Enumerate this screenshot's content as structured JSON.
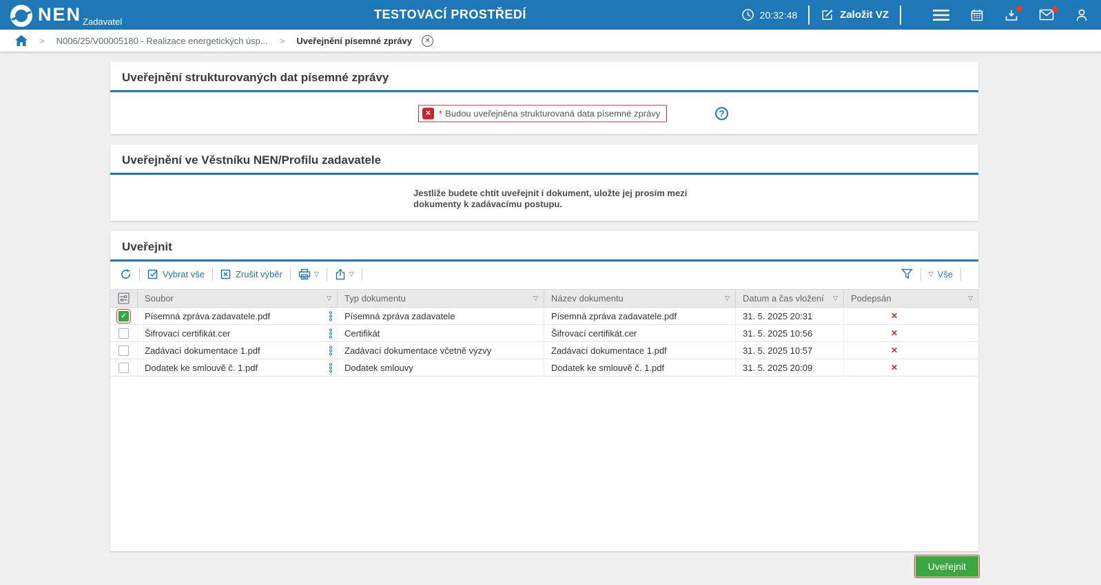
{
  "colors": {
    "topbar_blue": "#1e78b7",
    "accent_blue": "#1e78b7",
    "error_red": "#d02c2c",
    "button_green": "#3aa740",
    "check_green": "#33a942"
  },
  "icons": {
    "chevron": ">",
    "caret_down": "▽",
    "check": "✓",
    "close": "✕",
    "question": "?",
    "asterisk": "*"
  },
  "topbar": {
    "logo": "NEN",
    "logo_subtitle": "Zadavatel",
    "environment_title": "TESTOVACÍ PROSTŘEDÍ",
    "clock": "20:32:48",
    "create_button": "Založit VZ"
  },
  "breadcrumb": {
    "procurement": "N006/25/V00005180 - Realizace energetických úsp...",
    "current": "Uveřejnění písemné zprávy"
  },
  "section_structured_data": {
    "title": "Uveřejnění strukturovaných dat písemné zprávy",
    "notice": "Budou uveřejněna strukturovaná data písemné zprávy"
  },
  "section_bulletin": {
    "title": "Uveřejnění ve Věstníku NEN/Profilu zadavatele",
    "note": "Jestliže budete chtít uveřejnit i dokument, uložte jej prosím mezi dokumenty k zadávacímu postupu."
  },
  "section_publish": {
    "title": "Uveřejnit",
    "toolbar": {
      "select_all": "Vybrat vše",
      "clear_selection": "Zrušit výběr",
      "filter_scope": "Vše"
    },
    "table": {
      "columns": [
        "Soubor",
        "Typ dokumentu",
        "Název dokumentu",
        "Datum a čas vložení",
        "Podepsán"
      ],
      "rows": [
        {
          "checked": true,
          "file": "Písemná zpráva zadavatele.pdf",
          "type": "Písemná zpráva zadavatele",
          "name": "Písemná zpráva zadavatele.pdf",
          "date": "31. 5. 2025 20:31",
          "signed": "✕"
        },
        {
          "checked": false,
          "file": "Šifrovací certifikát.cer",
          "type": "Certifikát",
          "name": "Šifrovací certifikát.cer",
          "date": "31. 5. 2025 10:56",
          "signed": "✕"
        },
        {
          "checked": false,
          "file": "Zadávací dokumentace 1.pdf",
          "type": "Zadávací dokumentace včetně výzvy",
          "name": "Zadávací dokumentace 1.pdf",
          "date": "31. 5. 2025 10:57",
          "signed": "✕"
        },
        {
          "checked": false,
          "file": "Dodatek ke smlouvě č. 1.pdf",
          "type": "Dodatek smlouvy",
          "name": "Dodatek ke smlouvě č. 1.pdf",
          "date": "31. 5. 2025 20:09",
          "signed": "✕"
        }
      ]
    }
  },
  "footer": {
    "publish_button": "Uveřejnit"
  }
}
